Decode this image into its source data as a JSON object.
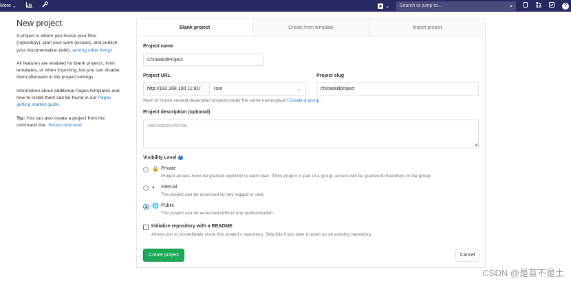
{
  "navbar": {
    "more_label": "More",
    "more_chevron": "⌄",
    "activity_icon": "chart-icon",
    "admin_icon": "wrench-icon",
    "plus_icon": "plus-square-icon",
    "plus_chevron": "⌄",
    "search_placeholder": "Search or jump to...",
    "search_icon": "⌕",
    "todo_icon": "todo-icon",
    "merge_icon": "merge-request-icon",
    "issues_icon": "issues-icon",
    "help_label": "?",
    "bg_color": "#292961"
  },
  "sidebar": {
    "title": "New project",
    "intro_text": "A project is where you house your files (repository), plan your work (issues), and publish your documentation (wiki),",
    "intro_link": "among other things.",
    "features_text": "All features are enabled for blank projects, from templates, or when importing, but you can disable them afterward in the project settings.",
    "pages_text": "Information about additional Pages templates and how to install them can be found in our",
    "pages_link": "Pages getting started guide.",
    "tip_label": "Tip:",
    "tip_text": "You can also create a project from the command line.",
    "tip_link": "Show command"
  },
  "tabs": [
    {
      "label": "Blank project",
      "active": true
    },
    {
      "label": "Create from template",
      "active": false
    },
    {
      "label": "Import project",
      "active": false
    }
  ],
  "form": {
    "project_name_label": "Project name",
    "project_name_value": "ChinaskillProject",
    "project_url_label": "Project URL",
    "url_prefix": "http://192.168.100.11:81/",
    "namespace_value": "root",
    "namespace_chevron": "⌄",
    "project_slug_label": "Project slug",
    "project_slug_value": "chinaskillproject",
    "namespace_help": "Want to house several dependent projects under the same namespace?",
    "namespace_help_link": "Create a group.",
    "description_label": "Project description (optional)",
    "description_placeholder": "Description format",
    "visibility_label": "Visibility Level",
    "visibility_help": "?",
    "visibility_options": [
      {
        "title": "Private",
        "icon": "🔒",
        "description": "Project access must be granted explicitly to each user. If this project is part of a group, access will be granted to members of the group.",
        "checked": false
      },
      {
        "title": "Internal",
        "icon": "◐",
        "description": "The project can be accessed by any logged in user.",
        "checked": false
      },
      {
        "title": "Public",
        "icon": "🌐",
        "description": "The project can be accessed without any authentication.",
        "checked": true
      }
    ],
    "readme_label": "Initialize repository with a README",
    "readme_description": "Allows you to immediately clone this project's repository. Skip this if you plan to push up an existing repository.",
    "readme_checked": false,
    "create_button": "Create project",
    "cancel_button": "Cancel"
  },
  "watermark": "CSDN @是苴不是土",
  "colors": {
    "accent_link": "#1f78d1",
    "create_button": "#1aaa55"
  }
}
